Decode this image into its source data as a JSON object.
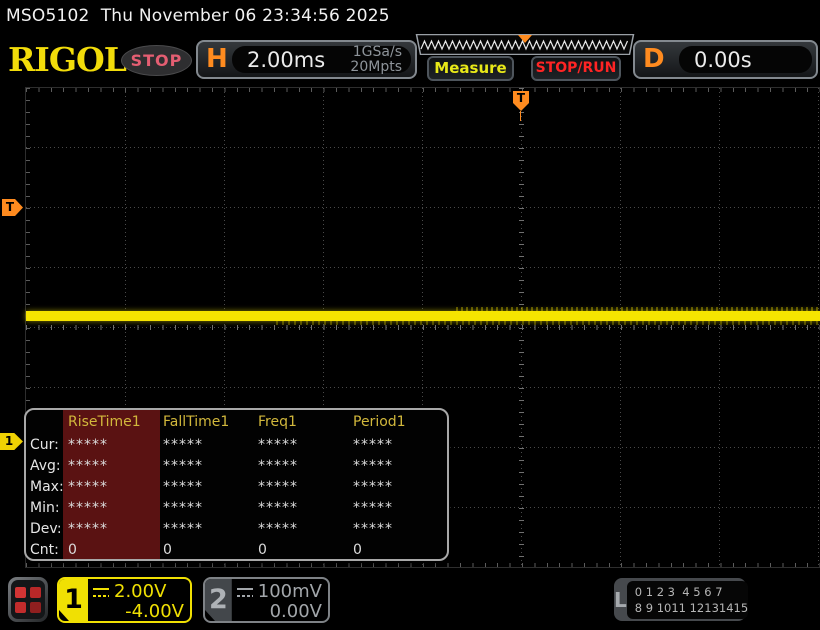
{
  "title_bar": {
    "text": "MSO5102  Thu November 06 23:34:56 2025"
  },
  "header": {
    "logo": "RIGOL",
    "acq_status": "STOP",
    "h_label": "H",
    "timebase": "2.00ms",
    "sample_rate": "1GSa/s",
    "memory_depth": "20Mpts",
    "measure_button": "Measure",
    "stoprun_button": "STOP/RUN",
    "d_label": "D",
    "delay": "0.00s"
  },
  "markers": {
    "trigger_position_label": "T",
    "trigger_level_label": "T",
    "channel1_label": "1"
  },
  "measure_table": {
    "columns": [
      "RiseTime1",
      "FallTime1",
      "Freq1",
      "Period1"
    ],
    "selected_column": "RiseTime1",
    "rows": [
      {
        "label": "Cur:",
        "values": [
          "*****",
          "*****",
          "*****",
          "*****"
        ]
      },
      {
        "label": "Avg:",
        "values": [
          "*****",
          "*****",
          "*****",
          "*****"
        ]
      },
      {
        "label": "Max:",
        "values": [
          "*****",
          "*****",
          "*****",
          "*****"
        ]
      },
      {
        "label": "Min:",
        "values": [
          "*****",
          "*****",
          "*****",
          "*****"
        ]
      },
      {
        "label": "Dev:",
        "values": [
          "*****",
          "*****",
          "*****",
          "*****"
        ]
      },
      {
        "label": "Cnt:",
        "values": [
          "0",
          "0",
          "0",
          "0"
        ]
      }
    ]
  },
  "bottom_bar": {
    "ch1": {
      "number": "1",
      "scale": "2.00V",
      "offset": "-4.00V"
    },
    "ch2": {
      "number": "2",
      "scale": "100mV",
      "offset": "0.00V"
    },
    "logic": {
      "label": "L",
      "row1": "0 1 2 3  4 5 6 7",
      "row2": "8 9 1011 12131415"
    }
  },
  "colors": {
    "ch1_yellow": "#f0e003",
    "trigger_orange": "#ff8b1f",
    "stoprun_red": "#ff2424",
    "measure_yellow": "#e8e818",
    "stop_pink": "#e45e72",
    "table_header_yellow": "#d2b83c",
    "selected_column_red": "#5a1212"
  }
}
